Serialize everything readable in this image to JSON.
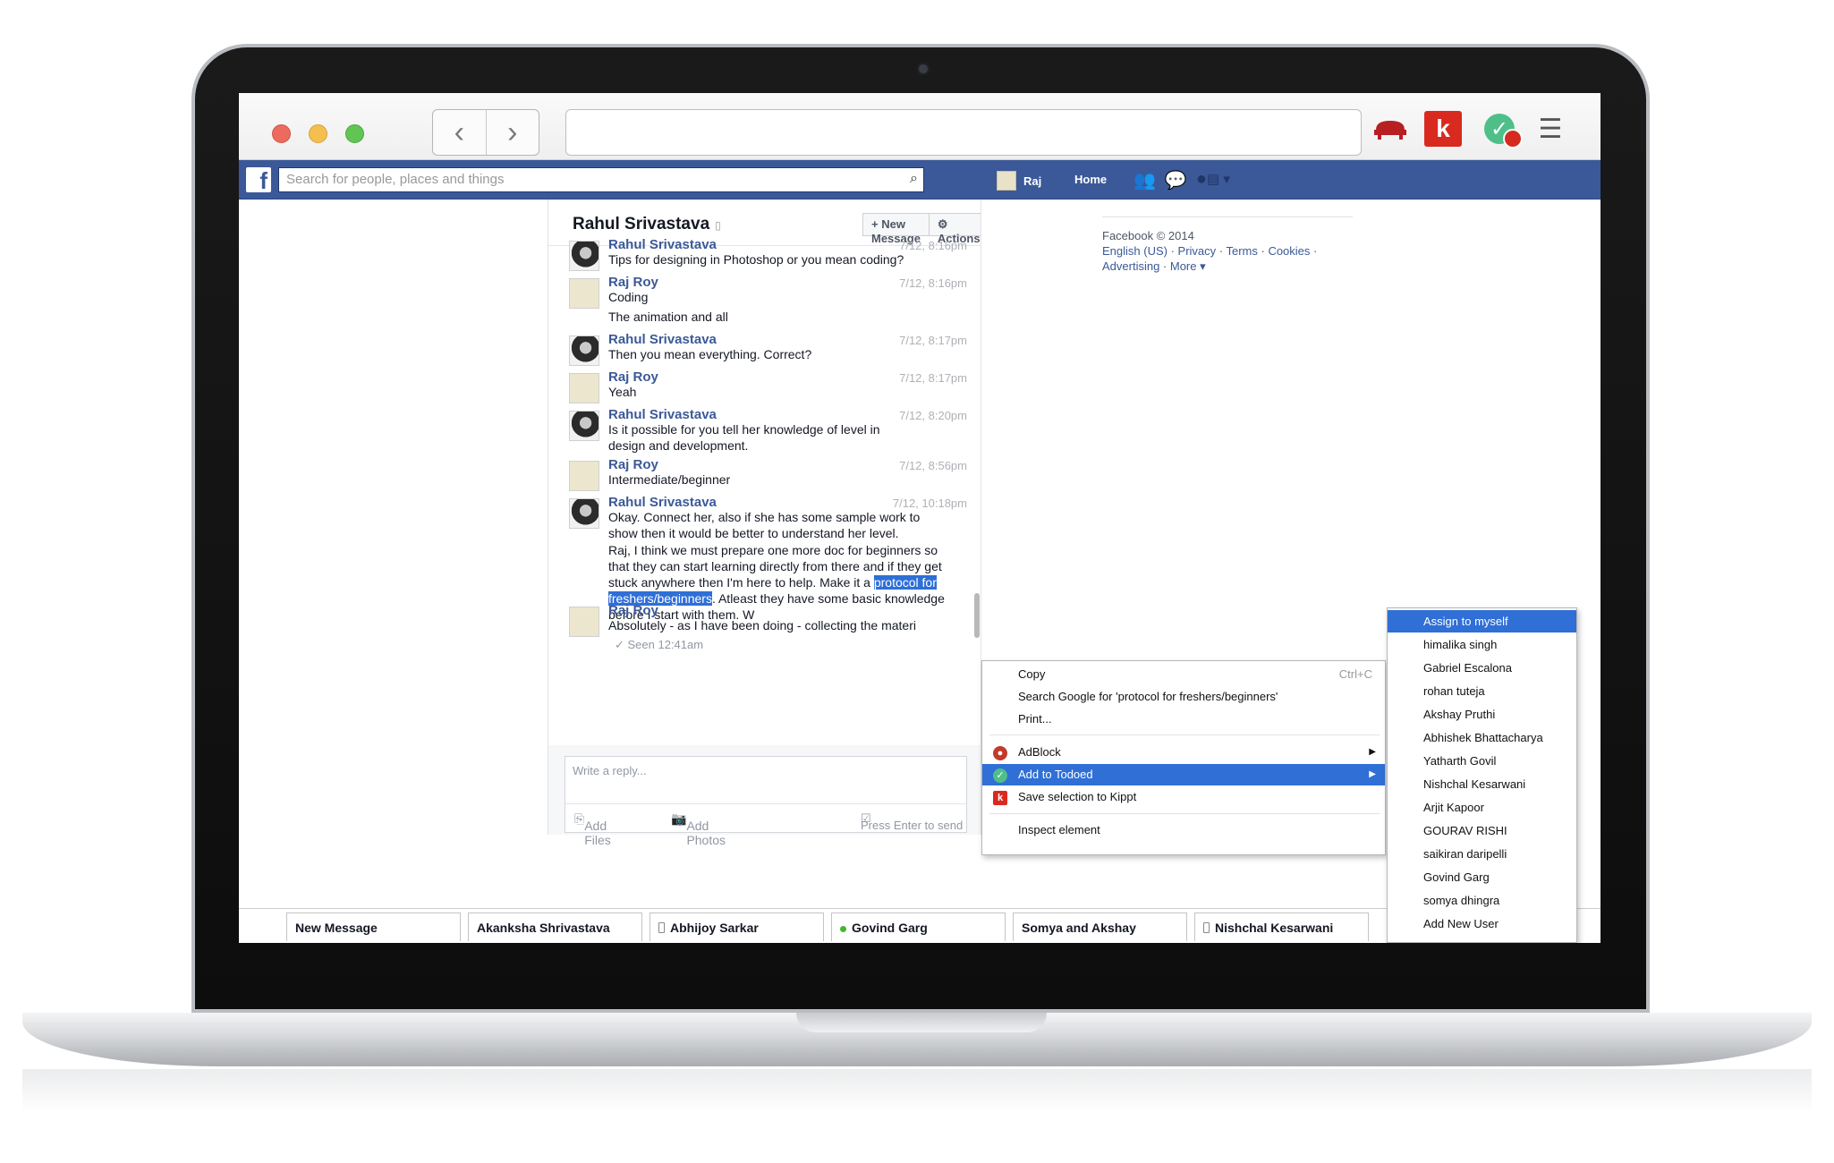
{
  "facebook": {
    "search_placeholder": "Search for people, places and things",
    "user_name": "Raj",
    "home_label": "Home"
  },
  "conversation": {
    "title": "Rahul Srivastava",
    "new_message_label": "New Message",
    "actions_label": "Actions",
    "messages": [
      {
        "name": "Rahul Srivastava",
        "time": "7/12, 8:16pm",
        "lines": [
          "Tips for designing in Photoshop or you mean coding?"
        ]
      },
      {
        "name": "Raj Roy",
        "time": "7/12, 8:16pm",
        "lines": [
          "Coding",
          "The animation and all"
        ]
      },
      {
        "name": "Rahul Srivastava",
        "time": "7/12, 8:17pm",
        "lines": [
          "Then you mean everything. Correct?"
        ]
      },
      {
        "name": "Raj Roy",
        "time": "7/12, 8:17pm",
        "lines": [
          "Yeah"
        ]
      },
      {
        "name": "Rahul Srivastava",
        "time": "7/12, 8:20pm",
        "lines": [
          "Is it possible for you tell her knowledge of level in design and development."
        ]
      },
      {
        "name": "Raj Roy",
        "time": "7/12, 8:56pm",
        "lines": [
          "Intermediate/beginner"
        ]
      },
      {
        "name": "Rahul Srivastava",
        "time": "7/12, 10:18pm",
        "lines": [
          "Okay. Connect her, also if she has some sample work to show then it would be better to understand her level."
        ]
      },
      {
        "name": "Raj Roy",
        "time": "",
        "lines": [
          "Absolutely - as I have been doing - collecting the materi"
        ]
      }
    ],
    "long_msg_before": "Raj, I think we must prepare one more doc for beginners so that they can start learning directly from there and if they get stuck anywhere then I'm here to help. Make it a ",
    "long_msg_selected": "protocol for freshers/beginners",
    "long_msg_after": ". Atleast they have some basic knowledge before I start with them. W",
    "seen": "Seen 12:41am",
    "reply_placeholder": "Write a reply...",
    "add_files": "Add Files",
    "add_photos": "Add Photos",
    "press_enter": "Press Enter to send"
  },
  "sidebar_footer": {
    "copyright": "Facebook © 2014",
    "links": [
      "English (US)",
      "Privacy",
      "Terms",
      "Cookies",
      "Advertising",
      "More"
    ]
  },
  "chat_tabs": [
    "New Message",
    "Akanksha Shrivastava",
    "Abhijoy Sarkar",
    "Govind Garg",
    "Somya and Akshay",
    "Nishchal Kesarwani"
  ],
  "context_menu": {
    "copy": "Copy",
    "copy_shortcut": "Ctrl+C",
    "search_google": "Search Google for 'protocol for freshers/beginners'",
    "print": "Print...",
    "adblock": "AdBlock",
    "add_to_todoed": "Add to Todoed",
    "save_kippt": "Save selection to Kippt",
    "inspect": "Inspect element"
  },
  "submenu": [
    "Assign to myself",
    "himalika singh",
    "Gabriel Escalona",
    "rohan tuteja",
    "Akshay Pruthi",
    "Abhishek Bhattacharya",
    "Yatharth Govil",
    "Nishchal Kesarwani",
    "Arjit Kapoor",
    "GOURAV RISHI",
    "saikiran daripelli",
    "Govind Garg",
    "somya dhingra",
    "Add New User"
  ],
  "icons": {
    "back": "chevron-left-icon",
    "forward": "chevron-right-icon",
    "pocket": "pocket-icon",
    "kippt": "kippt-icon",
    "todoed": "todoed-icon",
    "menu": "hamburger-icon"
  },
  "colors": {
    "facebook_blue": "#3b5998",
    "selection_blue": "#2f6fd6",
    "kippt_red": "#d92a1f",
    "todoed_green": "#4fbf8a"
  }
}
